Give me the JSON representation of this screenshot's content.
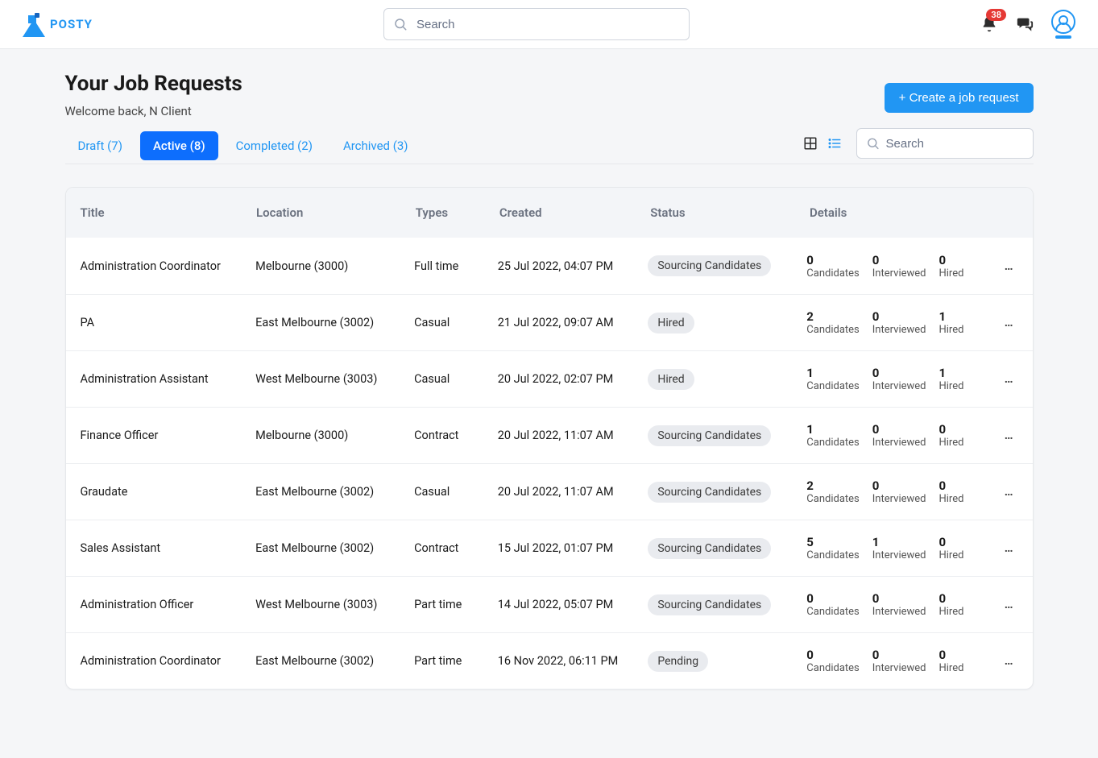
{
  "brand": {
    "name": "POSTY"
  },
  "topbar": {
    "search_placeholder": "Search",
    "notif_count": "38"
  },
  "page": {
    "title": "Your Job Requests",
    "subtitle": "Welcome back, N Client",
    "create_label": "+ Create a job request"
  },
  "tabs": {
    "draft": {
      "label": "Draft (7)"
    },
    "active": {
      "label": "Active (8)"
    },
    "completed": {
      "label": "Completed (2)"
    },
    "archived": {
      "label": "Archived (3)"
    }
  },
  "table_search_placeholder": "Search",
  "columns": {
    "title": "Title",
    "location": "Location",
    "types": "Types",
    "created": "Created",
    "status": "Status",
    "details": "Details"
  },
  "detail_labels": {
    "cand": "Candidates",
    "int": "Interviewed",
    "hired": "Hired"
  },
  "rows": [
    {
      "title": "Administration Coordinator",
      "location": "Melbourne (3000)",
      "types": "Full time",
      "created": "25 Jul 2022, 04:07 PM",
      "status": "Sourcing Candidates",
      "cand": "0",
      "int": "0",
      "hired": "0"
    },
    {
      "title": "PA",
      "location": "East Melbourne (3002)",
      "types": "Casual",
      "created": "21 Jul 2022, 09:07 AM",
      "status": "Hired",
      "cand": "2",
      "int": "0",
      "hired": "1"
    },
    {
      "title": "Administration Assistant",
      "location": "West Melbourne (3003)",
      "types": "Casual",
      "created": "20 Jul 2022, 02:07 PM",
      "status": "Hired",
      "cand": "1",
      "int": "0",
      "hired": "1"
    },
    {
      "title": "Finance Officer",
      "location": "Melbourne (3000)",
      "types": "Contract",
      "created": "20 Jul 2022, 11:07 AM",
      "status": "Sourcing Candidates",
      "cand": "1",
      "int": "0",
      "hired": "0"
    },
    {
      "title": "Graudate",
      "location": "East Melbourne (3002)",
      "types": "Casual",
      "created": "20 Jul 2022, 11:07 AM",
      "status": "Sourcing Candidates",
      "cand": "2",
      "int": "0",
      "hired": "0"
    },
    {
      "title": "Sales Assistant",
      "location": "East Melbourne (3002)",
      "types": "Contract",
      "created": "15 Jul 2022, 01:07 PM",
      "status": "Sourcing Candidates",
      "cand": "5",
      "int": "1",
      "hired": "0"
    },
    {
      "title": "Administration Officer",
      "location": "West Melbourne (3003)",
      "types": "Part time",
      "created": "14 Jul 2022, 05:07 PM",
      "status": "Sourcing Candidates",
      "cand": "0",
      "int": "0",
      "hired": "0"
    },
    {
      "title": "Administration Coordinator",
      "location": "East Melbourne (3002)",
      "types": "Part time",
      "created": "16 Nov 2022, 06:11 PM",
      "status": "Pending",
      "cand": "0",
      "int": "0",
      "hired": "0"
    }
  ]
}
